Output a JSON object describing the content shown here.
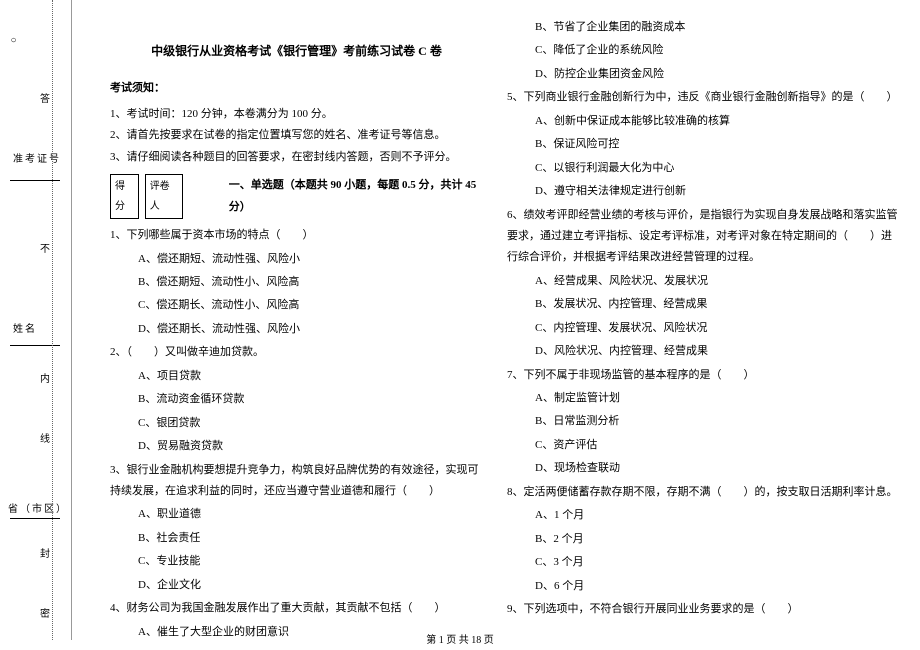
{
  "side": {
    "book": "○",
    "answer": "答",
    "id_label": "准考证号",
    "kun": "不",
    "name_label": "姓名",
    "nei": "内",
    "xian": "线",
    "region_label": "省（市区）",
    "feng": "封",
    "mi": "密"
  },
  "title": "中级银行从业资格考试《银行管理》考前练习试卷 C 卷",
  "notice": {
    "header": "考试须知：",
    "items": [
      "1、考试时间：120 分钟，本卷满分为 100 分。",
      "2、请首先按要求在试卷的指定位置填写您的姓名、准考证号等信息。",
      "3、请仔细阅读各种题目的回答要求，在密封线内答题，否则不予评分。"
    ]
  },
  "score": {
    "left": "得分",
    "right": "评卷人"
  },
  "section1": "一、单选题（本题共 90 小题，每题 0.5 分，共计 45 分）",
  "left_questions": [
    {
      "stem": "1、下列哪些属于资本市场的特点（　　）",
      "opts": [
        "A、偿还期短、流动性强、风险小",
        "B、偿还期短、流动性小、风险高",
        "C、偿还期长、流动性小、风险高",
        "D、偿还期长、流动性强、风险小"
      ]
    },
    {
      "stem": "2、（　　）又叫做辛迪加贷款。",
      "opts": [
        "A、项目贷款",
        "B、流动资金循环贷款",
        "C、银团贷款",
        "D、贸易融资贷款"
      ]
    },
    {
      "stem": "3、银行业金融机构要想提升竞争力，构筑良好品牌优势的有效途径，实现可持续发展，在追求利益的同时，还应当遵守营业道德和履行（　　）",
      "opts": [
        "A、职业道德",
        "B、社会责任",
        "C、专业技能",
        "D、企业文化"
      ]
    },
    {
      "stem": "4、财务公司为我国金融发展作出了重大贡献，其贡献不包括（　　）",
      "opts": [
        "A、催生了大型企业的财团意识"
      ]
    }
  ],
  "right_top_opts": [
    "B、节省了企业集团的融资成本",
    "C、降低了企业的系统风险",
    "D、防控企业集团资金风险"
  ],
  "right_questions": [
    {
      "stem": "5、下列商业银行金融创新行为中，违反《商业银行金融创新指导》的是（　　）",
      "opts": [
        "A、创新中保证成本能够比较准确的核算",
        "B、保证风险可控",
        "C、以银行利润最大化为中心",
        "D、遵守相关法律规定进行创新"
      ]
    },
    {
      "stem": "6、绩效考评即经营业绩的考核与评价，是指银行为实现自身发展战略和落实监管要求，通过建立考评指标、设定考评标准，对考评对象在特定期间的（　　）进行综合评价，并根据考评结果改进经营管理的过程。",
      "opts": [
        "A、经营成果、风险状况、发展状况",
        "B、发展状况、内控管理、经营成果",
        "C、内控管理、发展状况、风险状况",
        "D、风险状况、内控管理、经营成果"
      ]
    },
    {
      "stem": "7、下列不属于非现场监管的基本程序的是（　　）",
      "opts": [
        "A、制定监管计划",
        "B、日常监测分析",
        "C、资产评估",
        "D、现场检查联动"
      ]
    },
    {
      "stem": "8、定活两便储蓄存款存期不限，存期不满（　　）的，按支取日活期利率计息。",
      "opts": [
        "A、1 个月",
        "B、2 个月",
        "C、3 个月",
        "D、6 个月"
      ]
    },
    {
      "stem": "9、下列选项中，不符合银行开展同业业务要求的是（　　）",
      "opts": []
    }
  ],
  "footer": "第 1 页 共 18 页"
}
